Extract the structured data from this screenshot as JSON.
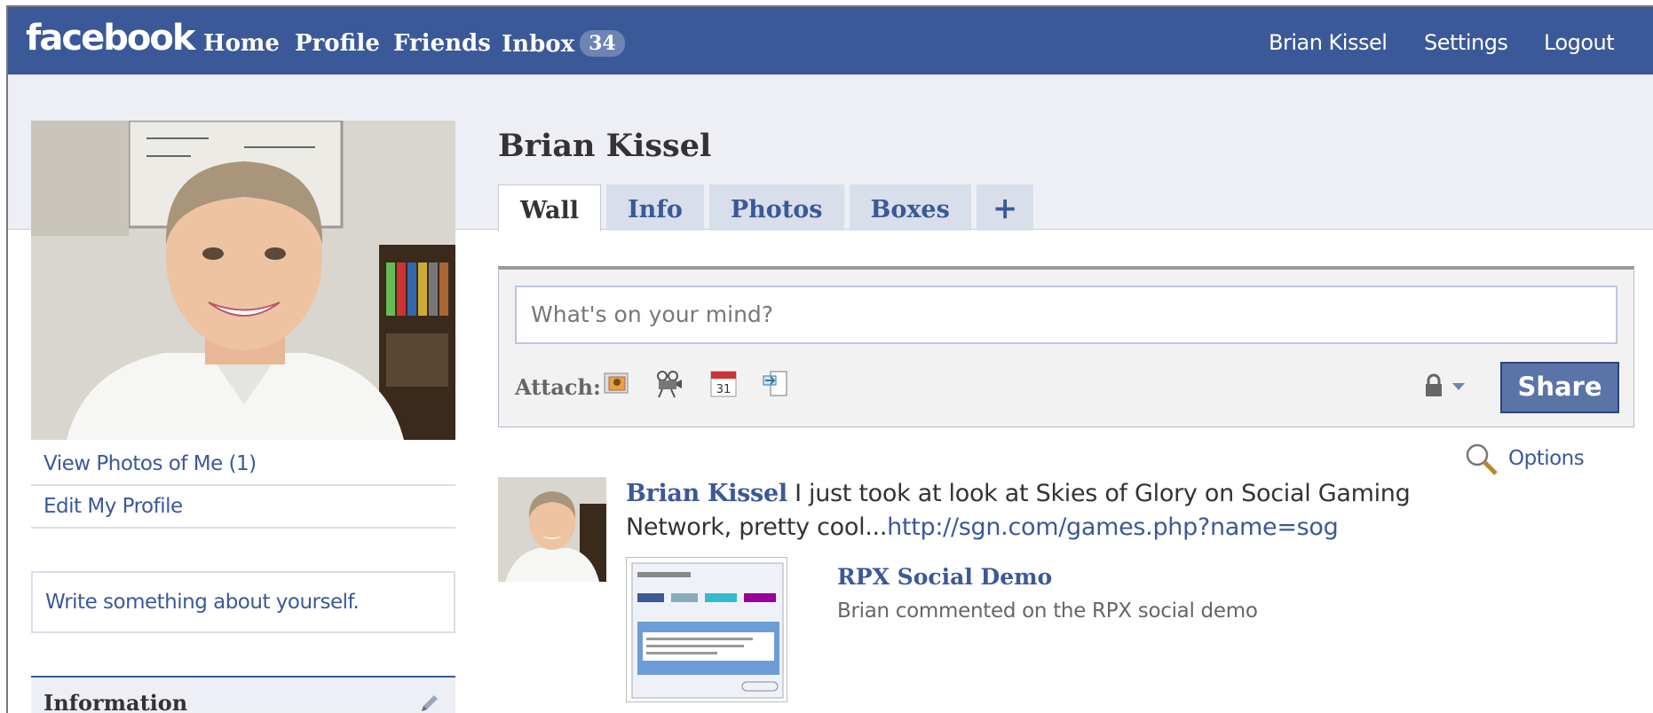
{
  "topbar": {
    "logo": "facebook",
    "nav": {
      "home": "Home",
      "profile": "Profile",
      "friends": "Friends",
      "inbox": "Inbox",
      "inbox_count": "34"
    },
    "right": {
      "user": "Brian Kissel",
      "settings": "Settings",
      "logout": "Logout"
    },
    "color": "#3b5998"
  },
  "left": {
    "links": [
      "View Photos of Me (1)",
      "Edit My Profile"
    ],
    "about_placeholder": "Write something about yourself.",
    "info_heading": "Information"
  },
  "profile": {
    "name": "Brian Kissel",
    "tabs": [
      "Wall",
      "Info",
      "Photos",
      "Boxes",
      "+"
    ],
    "active_tab": "Wall"
  },
  "composer": {
    "placeholder": "What's on your mind?",
    "attach_label": "Attach:",
    "attach_icons": [
      "photo-icon",
      "video-icon",
      "event-icon",
      "link-icon"
    ],
    "share_label": "Share",
    "privacy_icon": "lock-icon"
  },
  "feed": {
    "options_label": "Options",
    "story": {
      "actor": "Brian Kissel",
      "text": " I just took at look at Skies of Glory on Social Gaming Network, pretty cool...",
      "link": "http://sgn.com/games.php?name=sog",
      "attachment_title": "RPX Social Demo",
      "attachment_desc": "Brian commented on the RPX social demo"
    }
  }
}
